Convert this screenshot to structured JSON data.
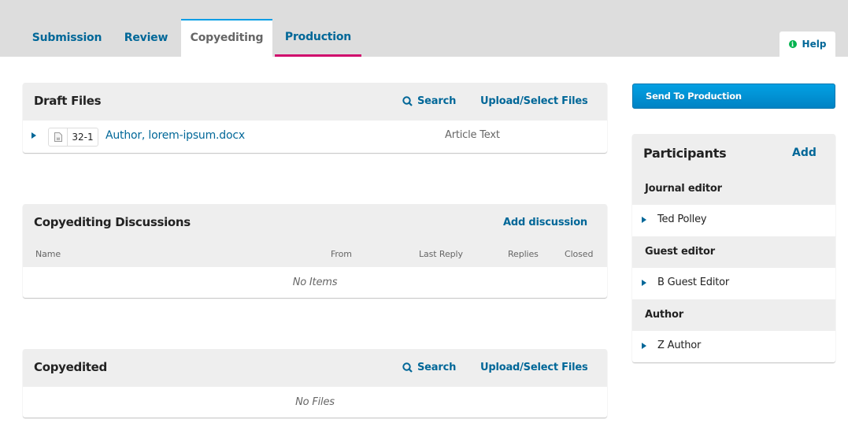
{
  "tabs": [
    {
      "label": "Submission",
      "state": "default"
    },
    {
      "label": "Review",
      "state": "default"
    },
    {
      "label": "Copyediting",
      "state": "active"
    },
    {
      "label": "Production",
      "state": "underlined"
    }
  ],
  "help": {
    "label": "Help",
    "icon": "info-icon"
  },
  "colors": {
    "link": "#006798",
    "active_tab_border": "#009de5",
    "production_underline": "#d00a6c",
    "help_icon": "#00b24e",
    "button": "#0083c4"
  },
  "draft_files": {
    "title": "Draft Files",
    "search_label": "Search",
    "upload_label": "Upload/Select Files",
    "files": [
      {
        "id": "32-1",
        "icon": "word-doc-icon",
        "name": "Author, lorem-ipsum.docx",
        "type": "Article Text"
      }
    ]
  },
  "discussions": {
    "title": "Copyediting Discussions",
    "add_label": "Add discussion",
    "columns": [
      "Name",
      "From",
      "Last Reply",
      "Replies",
      "Closed"
    ],
    "empty_text": "No Items"
  },
  "copyedited": {
    "title": "Copyedited",
    "search_label": "Search",
    "upload_label": "Upload/Select Files",
    "empty_text": "No Files"
  },
  "send_button": {
    "label": "Send To Production"
  },
  "participants": {
    "title": "Participants",
    "add_label": "Add",
    "groups": [
      {
        "role": "Journal editor",
        "people": [
          "Ted Polley"
        ]
      },
      {
        "role": "Guest editor",
        "people": [
          "B Guest Editor"
        ]
      },
      {
        "role": "Author",
        "people": [
          "Z Author"
        ]
      }
    ]
  }
}
